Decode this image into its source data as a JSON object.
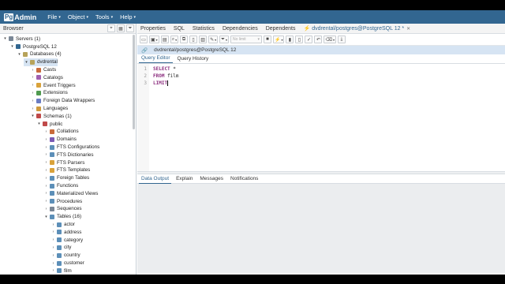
{
  "app": {
    "logo_prefix": "Pg",
    "logo_suffix": "Admin"
  },
  "menu": [
    {
      "label": "File"
    },
    {
      "label": "Object"
    },
    {
      "label": "Tools"
    },
    {
      "label": "Help"
    }
  ],
  "browser": {
    "title": "Browser",
    "tree": [
      {
        "label": "Servers (1)",
        "tog": "▾",
        "icon_color": "#7a8796",
        "name": "servers"
      },
      {
        "label": "PostgreSQL 12",
        "tog": "▾",
        "icon_color": "#326690",
        "name": "postgresql-12"
      },
      {
        "label": "Databases (4)",
        "tog": "▾",
        "icon_color": "#b7a35a",
        "name": "databases"
      },
      {
        "label": "dvdrental",
        "tog": "▾",
        "icon_color": "#b7a35a",
        "name": "dvdrental"
      },
      {
        "label": "Casts",
        "tog": "›",
        "icon_color": "#c96a3b",
        "name": "casts"
      },
      {
        "label": "Catalogs",
        "tog": "›",
        "icon_color": "#a05fb0",
        "name": "catalogs"
      },
      {
        "label": "Event Triggers",
        "tog": "›",
        "icon_color": "#d9a23a",
        "name": "event-triggers"
      },
      {
        "label": "Extensions",
        "tog": "›",
        "icon_color": "#4f9a4f",
        "name": "extensions"
      },
      {
        "label": "Foreign Data Wrappers",
        "tog": "›",
        "icon_color": "#6a7cc2",
        "name": "foreign-data-wrappers"
      },
      {
        "label": "Languages",
        "tog": "›",
        "icon_color": "#cf9a3c",
        "name": "languages"
      },
      {
        "label": "Schemas (1)",
        "tog": "▾",
        "icon_color": "#c04a4a",
        "name": "schemas"
      },
      {
        "label": "public",
        "tog": "▾",
        "icon_color": "#c04a4a",
        "name": "public"
      },
      {
        "label": "Collations",
        "tog": "›",
        "icon_color": "#c96a3b",
        "name": "collations"
      },
      {
        "label": "Domains",
        "tog": "›",
        "icon_color": "#7a5bb5",
        "name": "domains"
      },
      {
        "label": "FTS Configurations",
        "tog": "›",
        "icon_color": "#5c8fb8",
        "name": "fts-configurations"
      },
      {
        "label": "FTS Dictionaries",
        "tog": "›",
        "icon_color": "#5c8fb8",
        "name": "fts-dictionaries"
      },
      {
        "label": "FTS Parsers",
        "tog": "›",
        "icon_color": "#d9a23a",
        "name": "fts-parsers"
      },
      {
        "label": "FTS Templates",
        "tog": "›",
        "icon_color": "#d9a23a",
        "name": "fts-templates"
      },
      {
        "label": "Foreign Tables",
        "tog": "›",
        "icon_color": "#5c8fb8",
        "name": "foreign-tables"
      },
      {
        "label": "Functions",
        "tog": "›",
        "icon_color": "#5c8fb8",
        "name": "functions"
      },
      {
        "label": "Materialized Views",
        "tog": "›",
        "icon_color": "#5c8fb8",
        "name": "materialized-views"
      },
      {
        "label": "Procedures",
        "tog": "›",
        "icon_color": "#5c8fb8",
        "name": "procedures"
      },
      {
        "label": "Sequences",
        "tog": "›",
        "icon_color": "#7a8796",
        "name": "sequences"
      },
      {
        "label": "Tables (16)",
        "tog": "▾",
        "icon_color": "#5c8fb8",
        "name": "tables"
      },
      {
        "label": "actor",
        "tog": "›",
        "icon_color": "#5c8fb8",
        "name": "table-actor"
      },
      {
        "label": "address",
        "tog": "›",
        "icon_color": "#5c8fb8",
        "name": "table-address"
      },
      {
        "label": "category",
        "tog": "›",
        "icon_color": "#5c8fb8",
        "name": "table-category"
      },
      {
        "label": "city",
        "tog": "›",
        "icon_color": "#5c8fb8",
        "name": "table-city"
      },
      {
        "label": "country",
        "tog": "›",
        "icon_color": "#5c8fb8",
        "name": "table-country"
      },
      {
        "label": "customer",
        "tog": "›",
        "icon_color": "#5c8fb8",
        "name": "table-customer"
      },
      {
        "label": "film",
        "tog": "›",
        "icon_color": "#5c8fb8",
        "name": "table-film"
      }
    ]
  },
  "tabs": [
    {
      "label": "Properties"
    },
    {
      "label": "SQL"
    },
    {
      "label": "Statistics"
    },
    {
      "label": "Dependencies"
    },
    {
      "label": "Dependents"
    },
    {
      "label": "dvdrental/postgres@PostgreSQL 12 *"
    }
  ],
  "toolbar": {
    "limit_placeholder": "No limit"
  },
  "connection": {
    "text": "dvdrental/postgres@PostgreSQL 12"
  },
  "editor_tabs": [
    {
      "label": "Query Editor"
    },
    {
      "label": "Query History"
    }
  ],
  "editor": {
    "lines": [
      {
        "num": "1",
        "kw": "SELECT",
        "rest": " *"
      },
      {
        "num": "2",
        "kw": "FROM",
        "rest": " film"
      },
      {
        "num": "3",
        "kw": "LIMIT",
        "rest": ""
      }
    ]
  },
  "output_tabs": [
    {
      "label": "Data Output"
    },
    {
      "label": "Explain"
    },
    {
      "label": "Messages"
    },
    {
      "label": "Notifications"
    }
  ]
}
